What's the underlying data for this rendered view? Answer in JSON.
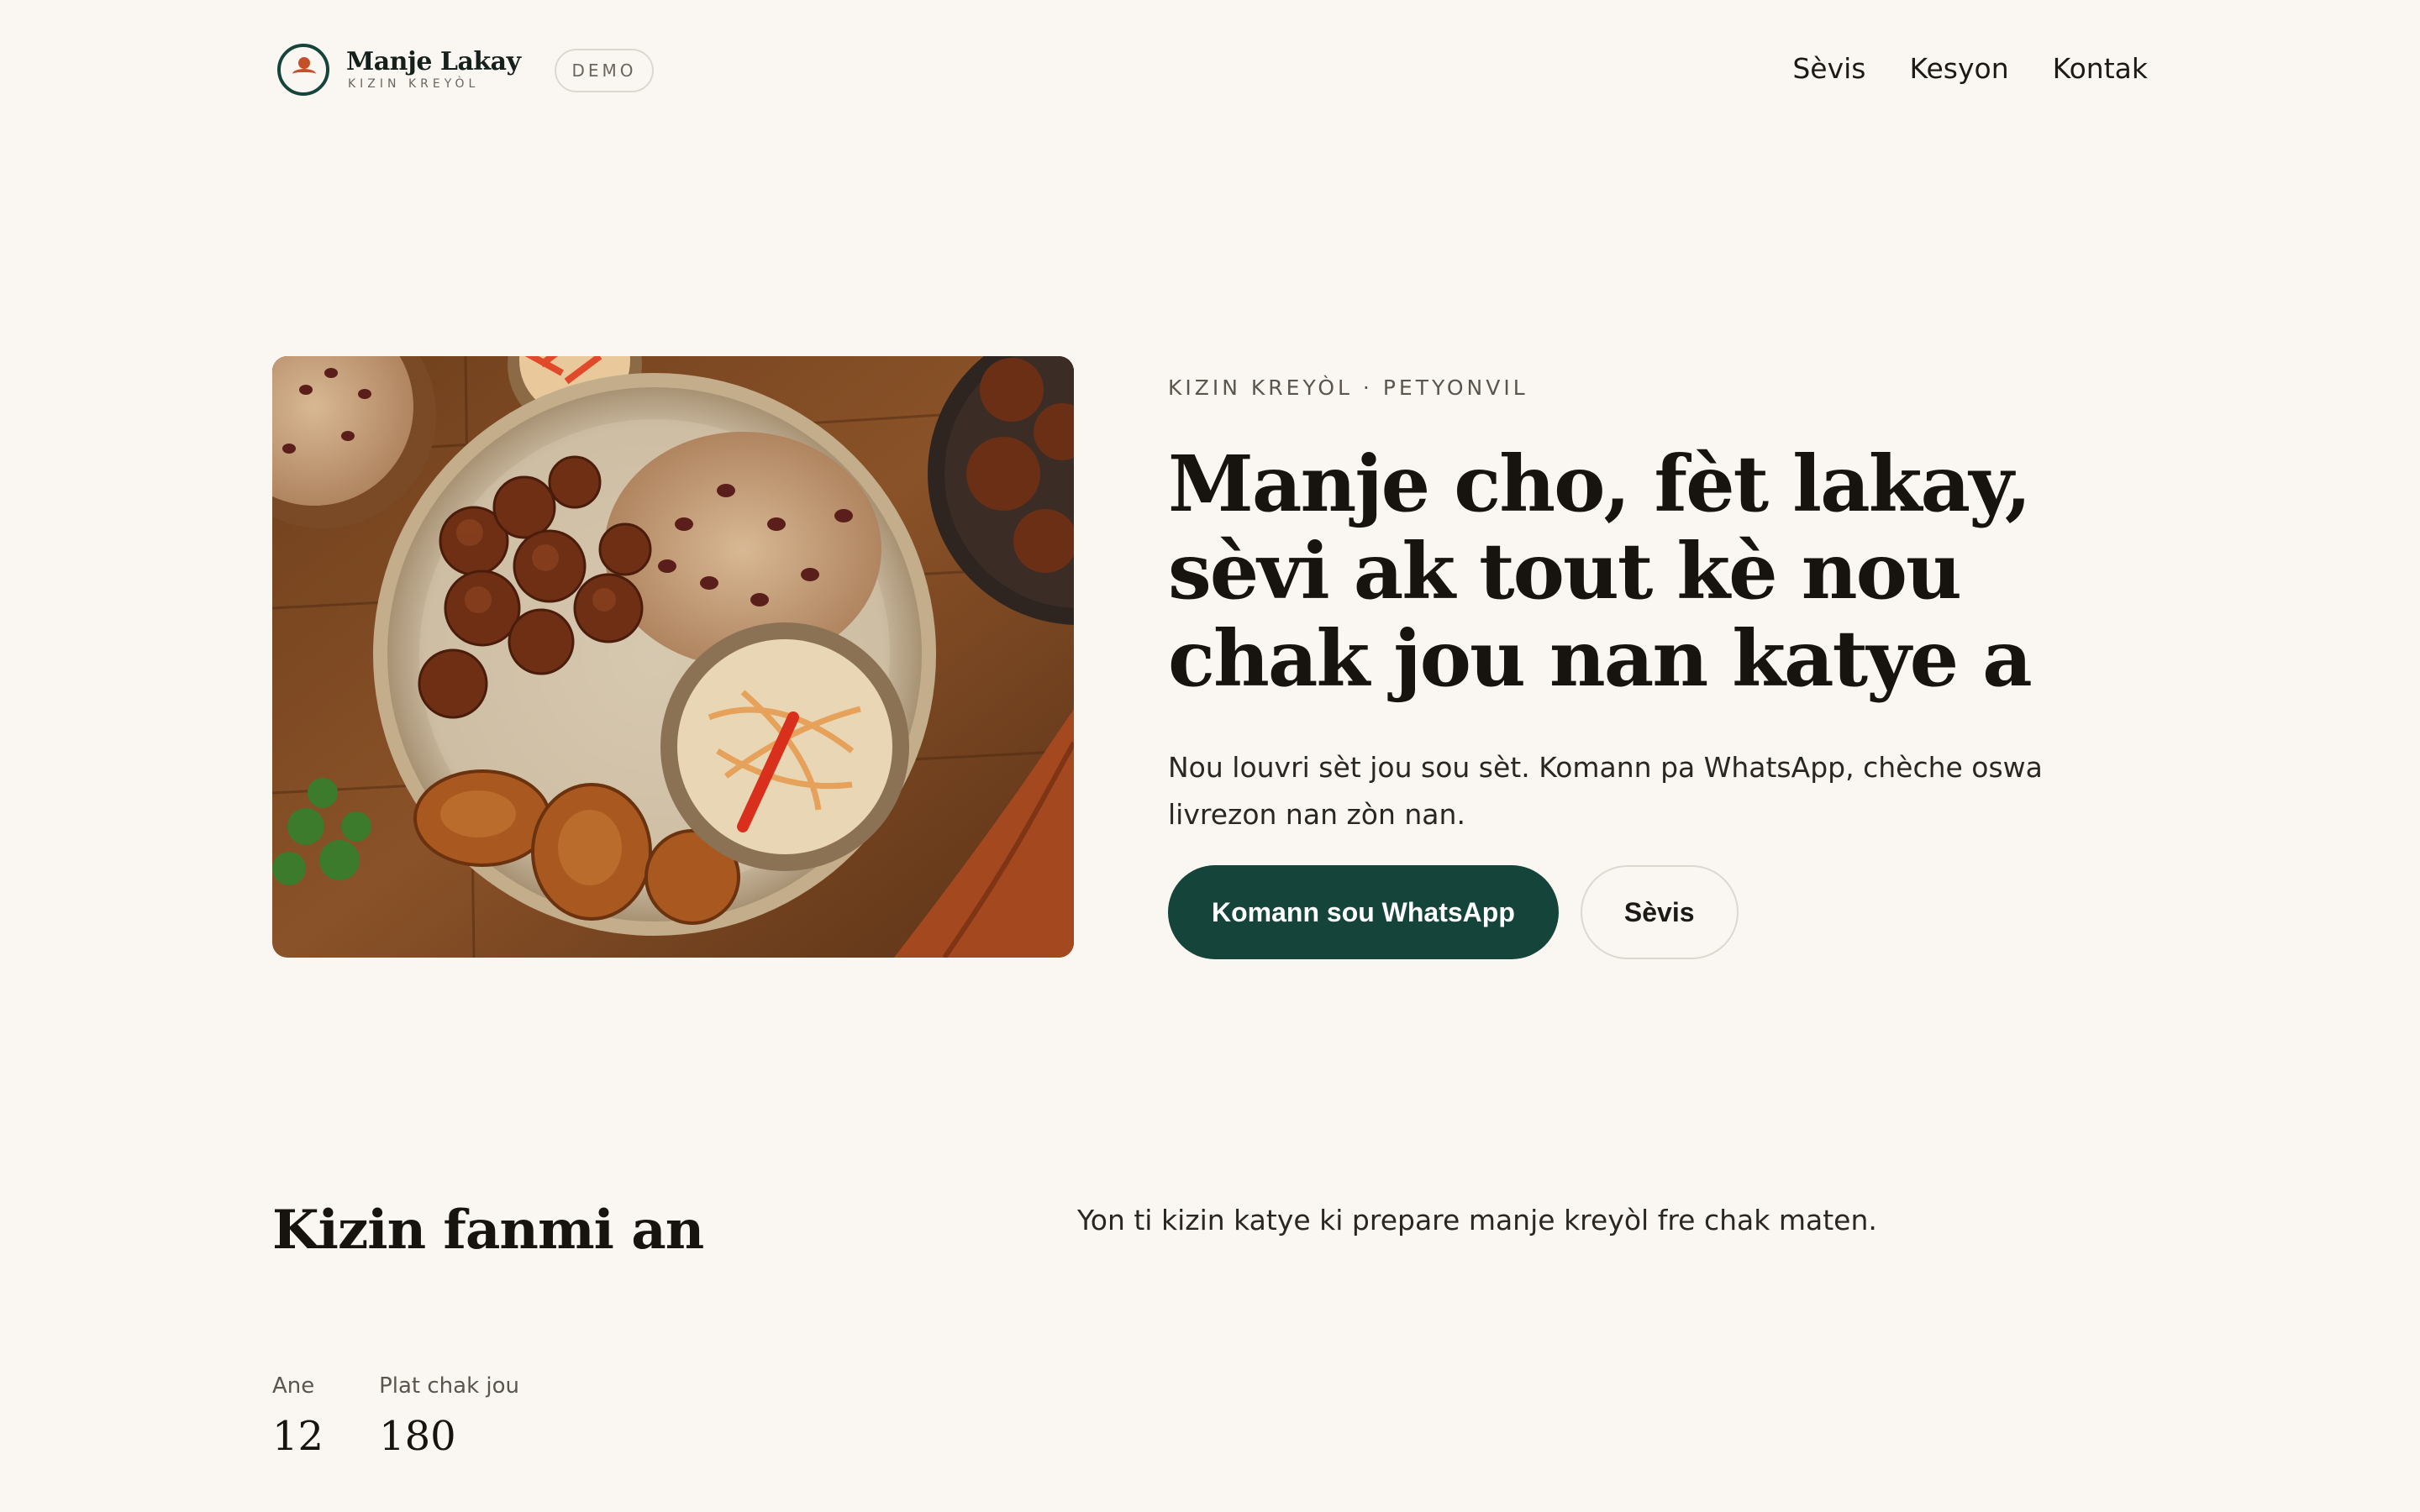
{
  "brand": {
    "name": "Manje Lakay",
    "tagline": "KIZIN KREYÒL",
    "badge": "DEMO"
  },
  "nav": {
    "items": [
      {
        "label": "Sèvis"
      },
      {
        "label": "Kesyon"
      },
      {
        "label": "Kontak"
      }
    ]
  },
  "hero": {
    "image_alt": "Griot, diri ak pwa, bannann peze ak pikliz",
    "eyebrow": "KIZIN KREYÒL · PETYONVIL",
    "title": "Manje cho, fèt lakay, sèvi ak tout kè nou chak jou nan katye a",
    "description": "Nou louvri sèt jou sou sèt. Komann pa WhatsApp, chèche oswa livrezon nan zòn nan.",
    "primary_cta": "Komann sou WhatsApp",
    "secondary_cta": "Sèvis"
  },
  "about": {
    "title": "Kizin fanmi an",
    "description": "Yon ti kizin katye ki prepare manje kreyòl fre chak maten.",
    "stats": [
      {
        "label": "Ane",
        "value": "12"
      },
      {
        "label": "Plat chak jou",
        "value": "180"
      }
    ]
  },
  "colors": {
    "background": "#faf7f2",
    "primary": "#15443a",
    "accent": "#c4502a",
    "text": "#1c1a17"
  }
}
